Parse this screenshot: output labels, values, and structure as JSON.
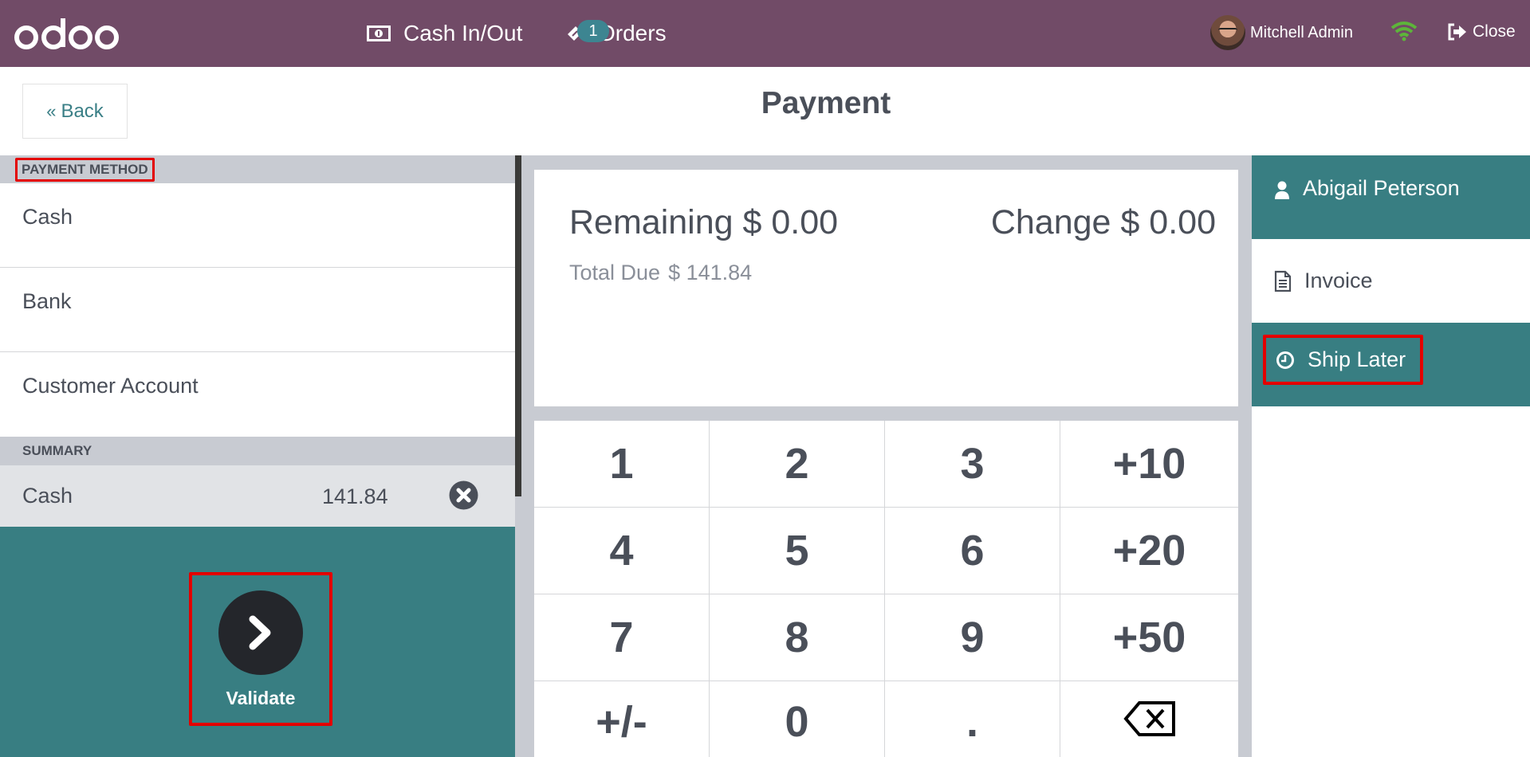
{
  "topbar": {
    "logo": "odoo",
    "nav": [
      {
        "label": "Cash In/Out",
        "icon": "money-bill-icon"
      },
      {
        "label": "Orders",
        "icon": "ticket-icon",
        "badge": "1"
      }
    ],
    "user_name": "Mitchell Admin",
    "connection_icon": "wifi-icon",
    "close_label": "Close"
  },
  "header": {
    "back_label": "Back",
    "title": "Payment"
  },
  "payment_methods": {
    "header": "PAYMENT METHOD",
    "items": [
      {
        "label": "Cash"
      },
      {
        "label": "Bank"
      },
      {
        "label": "Customer Account"
      }
    ]
  },
  "summary": {
    "header": "SUMMARY",
    "lines": [
      {
        "method": "Cash",
        "amount": "141.84"
      }
    ]
  },
  "validate": {
    "label": "Validate"
  },
  "status": {
    "remaining_label": "Remaining",
    "remaining_value": "$ 0.00",
    "change_label": "Change",
    "change_value": "$ 0.00",
    "total_due_label": "Total Due",
    "total_due_value": "$ 141.84"
  },
  "numpad": {
    "keys": [
      "1",
      "2",
      "3",
      "+10",
      "4",
      "5",
      "6",
      "+20",
      "7",
      "8",
      "9",
      "+50",
      "+/-",
      "0",
      ".",
      "backspace"
    ]
  },
  "actions": {
    "customer": "Abigail Peterson",
    "invoice": "Invoice",
    "ship_later": "Ship Later"
  },
  "colors": {
    "brand": "#714B67",
    "accent": "#387E82",
    "badge": "#3D8591",
    "panel_gray": "#C8CBD2",
    "highlight": "#E30000",
    "wifi_ok": "#5DB53A"
  }
}
